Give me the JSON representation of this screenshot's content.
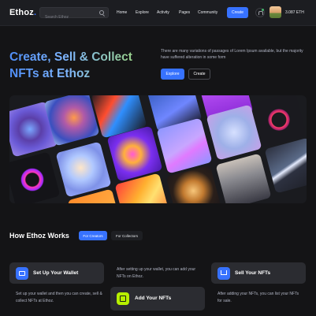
{
  "header": {
    "logo_main": "Ethoz",
    "logo_dot": ".",
    "search_placeholder": "Search Ethoz",
    "nav": [
      "Home",
      "Explore",
      "Activity",
      "Pages",
      "Community"
    ],
    "create_label": "Create",
    "balance": "3.087 ETH",
    "notification_dot_color": "#45b26b"
  },
  "hero": {
    "title_line1": "Create, Sell & Collect",
    "title_line2": "NFTs at Ethoz",
    "description": "There are many variations of passages of Lorem Ipsum available, but the majority have suffered alteration in some form",
    "explore_label": "Explore",
    "create_label": "Create"
  },
  "how": {
    "title": "How Ethoz Works",
    "tabs": [
      "For Creators",
      "For Collectors"
    ],
    "steps": [
      {
        "title": "Set Up Your Wallet",
        "description": "Set up your wallet and then you can create, sell & collect NFTs at Ethoz.",
        "icon": "wallet-icon",
        "color": "#3772ff"
      },
      {
        "title": "Add Your NFTs",
        "description": "After setting up your wallet, you can add your NFTs on Ethoz.",
        "icon": "add-image-icon",
        "color": "#b7f000"
      },
      {
        "title": "Sell Your NFTs",
        "description": "After adding your NFTs, you can list your NFTs for sale.",
        "icon": "cart-icon",
        "color": "#3772ff"
      }
    ]
  },
  "colors": {
    "accent": "#3772ff",
    "background": "#141416",
    "lime": "#b7f000"
  }
}
